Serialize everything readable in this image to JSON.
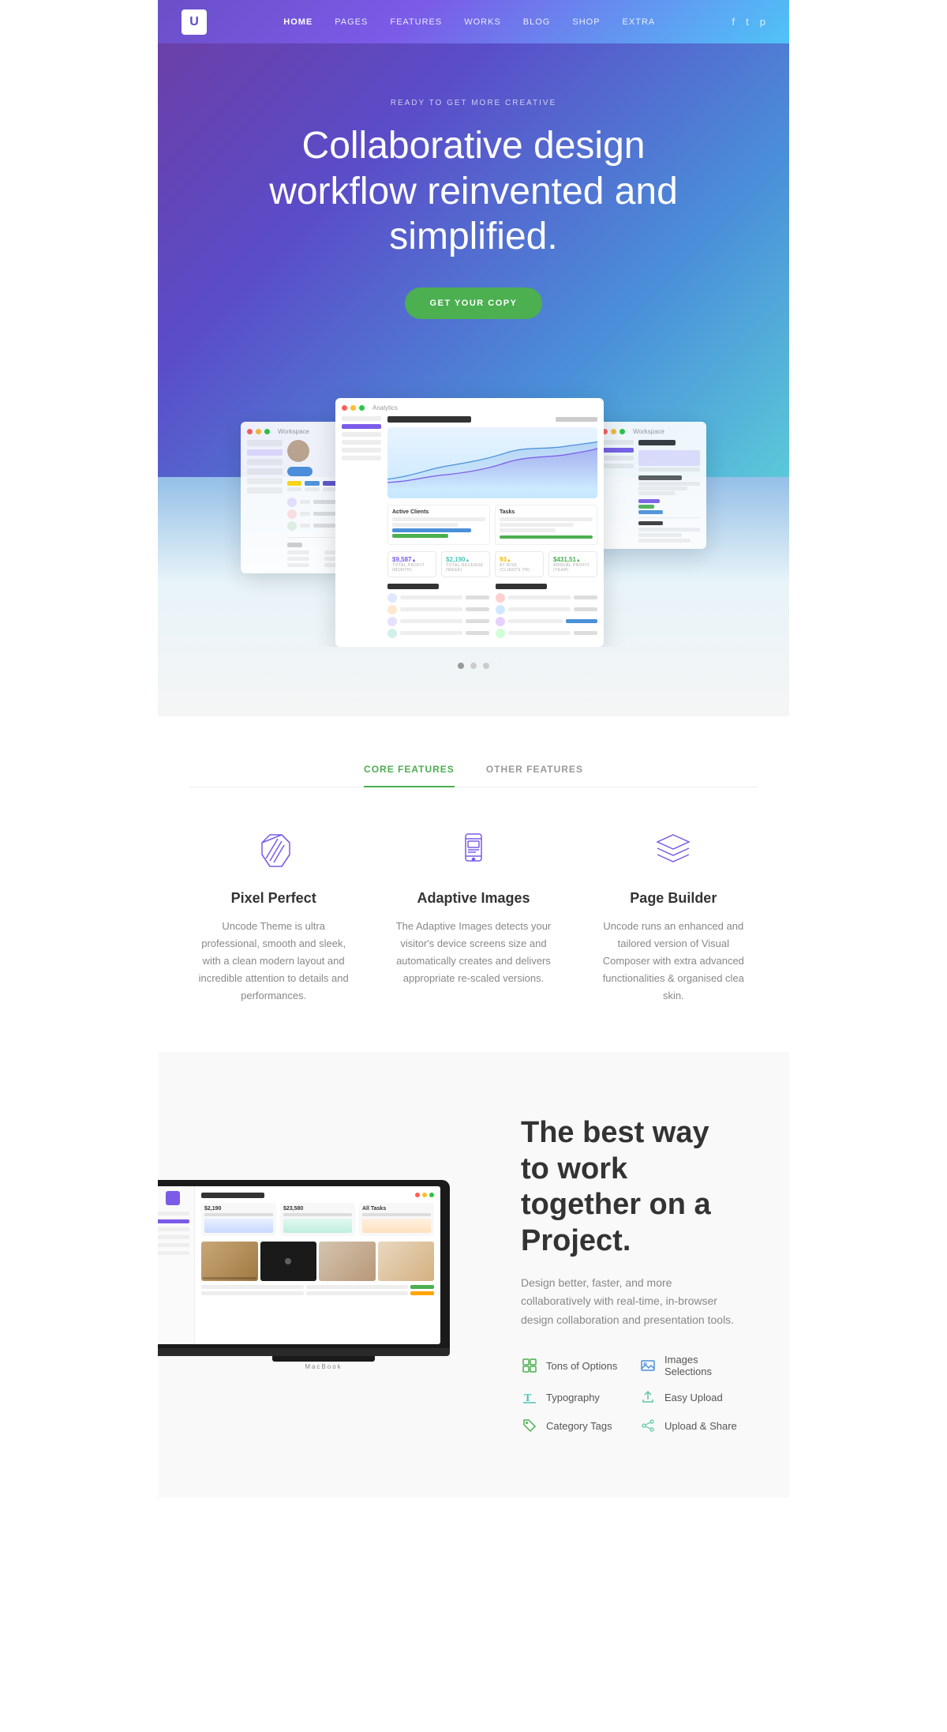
{
  "nav": {
    "logo": "U",
    "links": [
      {
        "label": "HOME",
        "active": true
      },
      {
        "label": "PAGES",
        "active": false
      },
      {
        "label": "FEATURES",
        "active": false
      },
      {
        "label": "WORKS",
        "active": false
      },
      {
        "label": "BLOG",
        "active": false
      },
      {
        "label": "SHOP",
        "active": false
      },
      {
        "label": "EXTRA",
        "active": false
      }
    ],
    "social": [
      "f",
      "t",
      "p"
    ]
  },
  "hero": {
    "tag": "READY TO GET MORE CREATIVE",
    "headline": "Collaborative design workflow reinvented and simplified.",
    "cta": "GET YOUR COPY"
  },
  "carousel": {
    "dots": [
      1,
      2,
      3
    ],
    "active_dot": 0
  },
  "features": {
    "tabs": [
      {
        "label": "CORE FEATURES",
        "active": true
      },
      {
        "label": "OTHER FEATURES",
        "active": false
      }
    ],
    "items": [
      {
        "title": "Pixel Perfect",
        "desc": "Uncode Theme is ultra professional, smooth and sleek, with a clean modern layout and incredible attention to details and performances."
      },
      {
        "title": "Adaptive Images",
        "desc": "The Adaptive Images detects your visitor's device screens size and automatically creates and delivers appropriate re-scaled versions."
      },
      {
        "title": "Page Builder",
        "desc": "Uncode runs an enhanced and tailored version of Visual Composer with extra advanced functionalities & organised clea skin."
      }
    ]
  },
  "laptop_section": {
    "headline": "The best way to work together on a Project.",
    "desc": "Design better, faster, and more collaboratively with real-time, in-browser design collaboration and presentation tools.",
    "features_list": [
      {
        "label": "Tons of Options",
        "icon_type": "green"
      },
      {
        "label": "Images Selections",
        "icon_type": "blue"
      },
      {
        "label": "Typography",
        "icon_type": "teal"
      },
      {
        "label": "Easy Upload",
        "icon_type": "upload"
      },
      {
        "label": "Category Tags",
        "icon_type": "green"
      },
      {
        "label": "Upload & Share",
        "icon_type": "upload"
      }
    ],
    "laptop_label": "MacBook"
  },
  "colors": {
    "accent_green": "#4caf50",
    "accent_blue": "#4a90d9",
    "accent_purple": "#7b5be8",
    "accent_teal": "#4fc3b8"
  }
}
